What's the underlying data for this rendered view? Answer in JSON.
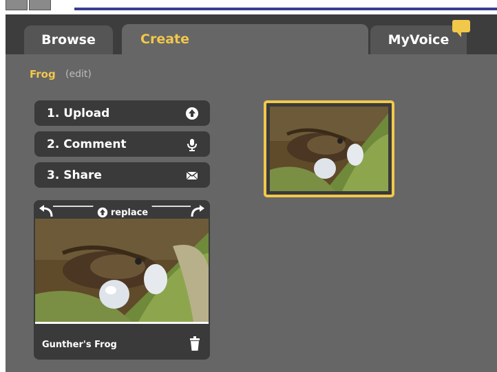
{
  "tabs": {
    "browse": "Browse",
    "create": "Create",
    "myvoice": "MyVoice"
  },
  "project": {
    "title": "Frog",
    "edit_label": "(edit)"
  },
  "steps": [
    {
      "label": "1. Upload",
      "icon": "upload-icon"
    },
    {
      "label": "2. Comment",
      "icon": "microphone-icon"
    },
    {
      "label": "3. Share",
      "icon": "envelope-icon"
    }
  ],
  "card": {
    "replace_label": "replace",
    "caption": "Gunther's Frog",
    "icons": [
      "rotate-left-icon",
      "rotate-right-icon",
      "trash-icon"
    ]
  },
  "colors": {
    "accent": "#f2c84b",
    "panel": "#666666",
    "dark": "#3a3a3a"
  }
}
